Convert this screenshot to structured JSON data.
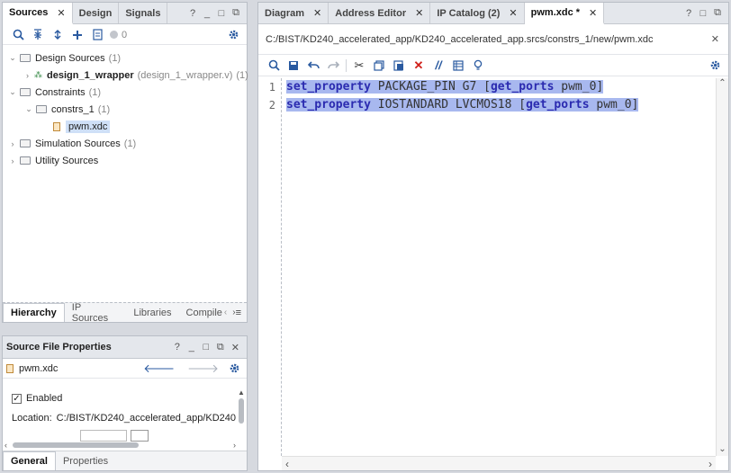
{
  "left_top": {
    "tabs": [
      {
        "label": "Sources"
      },
      {
        "label": "Design"
      },
      {
        "label": "Signals"
      }
    ],
    "window_buttons": [
      "?",
      "_",
      "□",
      "⧉"
    ],
    "tree": {
      "design_sources": {
        "label": "Design Sources",
        "count": "(1)"
      },
      "wrapper": {
        "label": "design_1_wrapper",
        "file": "(design_1_wrapper.v)",
        "count": "(1)"
      },
      "constraints": {
        "label": "Constraints",
        "count": "(1)"
      },
      "constrs": {
        "label": "constrs_1",
        "count": "(1)"
      },
      "xdc": {
        "label": "pwm.xdc"
      },
      "simulation": {
        "label": "Simulation Sources",
        "count": "(1)"
      },
      "utility": {
        "label": "Utility Sources"
      }
    },
    "status_count": "0",
    "bottom_tabs": [
      "Hierarchy",
      "IP Sources",
      "Libraries",
      "Compile"
    ]
  },
  "props": {
    "title": "Source File Properties",
    "window_buttons": [
      "?",
      "_",
      "□",
      "⧉",
      "✕"
    ],
    "file": "pwm.xdc",
    "enabled_label": "Enabled",
    "location_label": "Location:",
    "location_value": "C:/BIST/KD240_accelerated_app/KD240",
    "bottom_tabs": [
      "General",
      "Properties"
    ]
  },
  "editor": {
    "tabs": [
      {
        "label": "Diagram"
      },
      {
        "label": "Address Editor"
      },
      {
        "label": "IP Catalog (2)"
      },
      {
        "label": "pwm.xdc *"
      }
    ],
    "window_buttons": [
      "?",
      "□",
      "⧉"
    ],
    "path": "C:/BIST/KD240_accelerated_app/KD240_accelerated_app.srcs/constrs_1/new/pwm.xdc",
    "lines": [
      {
        "num": "1",
        "kw": "set_property",
        "mid": " PACKAGE_PIN G7 [",
        "kw2": "get_ports",
        "tail": " pwm_0]"
      },
      {
        "num": "2",
        "kw": "set_property",
        "mid": " IOSTANDARD LVCMOS18 [",
        "kw2": "get_ports",
        "tail": " pwm_0]"
      }
    ]
  },
  "colors": {
    "selection": "#a8b8ef",
    "keyword": "#2b2bb0",
    "accent": "#2a5aa0",
    "delete": "#d0201a"
  }
}
